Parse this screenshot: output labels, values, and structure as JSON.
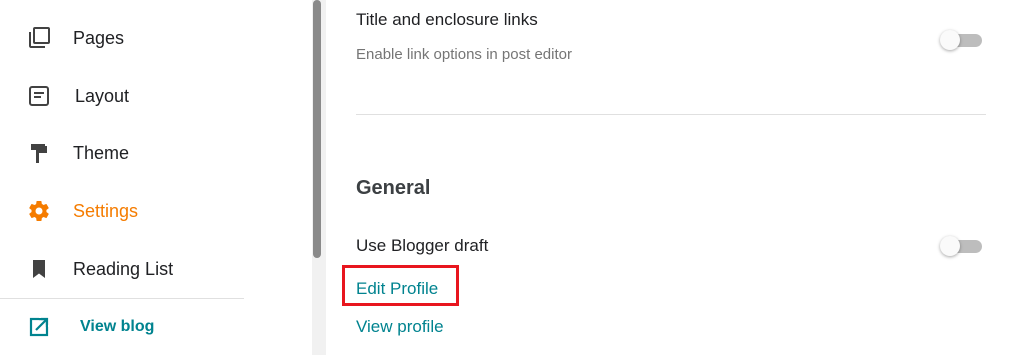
{
  "sidebar": {
    "items": [
      {
        "label": "Pages",
        "icon": "pages-icon"
      },
      {
        "label": "Layout",
        "icon": "layout-icon"
      },
      {
        "label": "Theme",
        "icon": "theme-roller-icon"
      },
      {
        "label": "Settings",
        "icon": "gear-icon",
        "active": true
      },
      {
        "label": "Reading List",
        "icon": "bookmark-icon"
      }
    ],
    "view_blog": {
      "label": "View blog",
      "icon": "open-in-new-icon"
    }
  },
  "main": {
    "title_links": {
      "title": "Title and enclosure links",
      "description": "Enable link options in post editor",
      "enabled": false
    },
    "general": {
      "heading": "General",
      "use_draft": {
        "title": "Use Blogger draft",
        "enabled": false
      },
      "edit_profile_link": "Edit Profile",
      "view_profile_link": "View profile"
    }
  },
  "colors": {
    "accent_active": "#f57c00",
    "link": "#00838f",
    "highlight": "#e8161e"
  }
}
